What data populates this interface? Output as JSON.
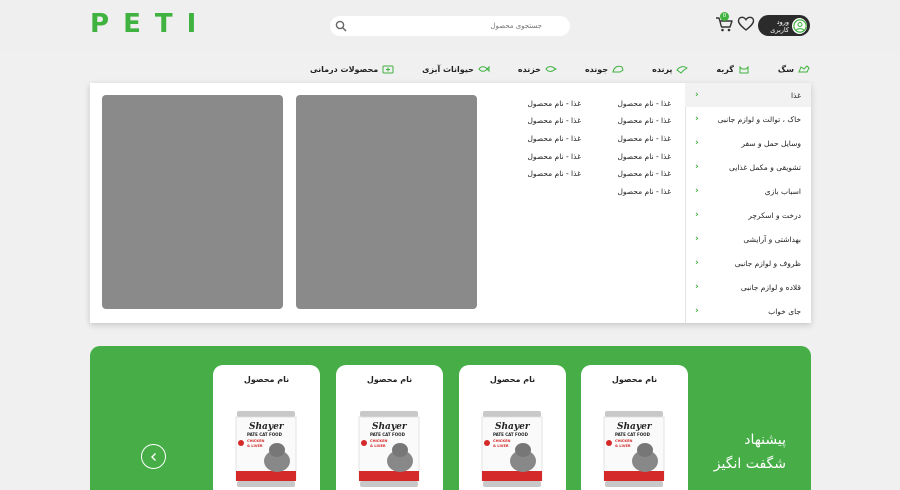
{
  "brand": {
    "logo_letters": [
      "P",
      "E",
      "T",
      "I"
    ],
    "accent": "#3fb23f",
    "promo_bg": "#47ae47"
  },
  "header": {
    "search_placeholder": "جستجوی محصول",
    "login_label": "ورود کاربری",
    "cart_count": "0"
  },
  "nav": {
    "items": [
      {
        "label": "سگ",
        "icon": "dog-icon"
      },
      {
        "label": "گربه",
        "icon": "cat-icon"
      },
      {
        "label": "پرنده",
        "icon": "bird-icon"
      },
      {
        "label": "جونده",
        "icon": "rodent-icon"
      },
      {
        "label": "خزنده",
        "icon": "reptile-icon"
      },
      {
        "label": "حیوانات آبزی",
        "icon": "fish-icon"
      },
      {
        "label": "محصولات درمانی",
        "icon": "medical-kit-icon"
      }
    ]
  },
  "mega_menu": {
    "categories": [
      "غذا",
      "خاک ، توالت و لوازم جانبی",
      "وسایل حمل و سفر",
      "تشویقی و مکمل غذایی",
      "اسباب بازی",
      "درخت و اسکرچر",
      "بهداشتی و آرایشی",
      "ظروف و لوازم جانبی",
      "قلاده و لوازم جانبی",
      "جای خواب"
    ],
    "active_category": 0,
    "col1": [
      "غذا - نام محصول",
      "غذا - نام محصول",
      "غذا - نام محصول",
      "غذا - نام محصول",
      "غذا - نام محصول",
      "غذا - نام محصول"
    ],
    "col2": [
      "غذا - نام محصول",
      "غذا - نام محصول",
      "غذا - نام محصول",
      "غذا - نام محصول",
      "غذا - نام محصول"
    ]
  },
  "promo": {
    "title_line1": "پیشنهاد",
    "title_line2": "شگفت انگیز",
    "cards": [
      {
        "name": "نام محصول",
        "can_brand": "Shayer",
        "can_line1": "PATE CAT FOOD",
        "can_line2": "CHICKEN",
        "can_line3": "& LIVER"
      },
      {
        "name": "نام محصول",
        "can_brand": "Shayer",
        "can_line1": "PATE CAT FOOD",
        "can_line2": "CHICKEN",
        "can_line3": "& LIVER"
      },
      {
        "name": "نام محصول",
        "can_brand": "Shayer",
        "can_line1": "PATE CAT FOOD",
        "can_line2": "CHICKEN",
        "can_line3": "& LIVER"
      },
      {
        "name": "نام محصول",
        "can_brand": "Shayer",
        "can_line1": "PATE CAT FOOD",
        "can_line2": "CHICKEN",
        "can_line3": "& LIVER"
      }
    ]
  }
}
